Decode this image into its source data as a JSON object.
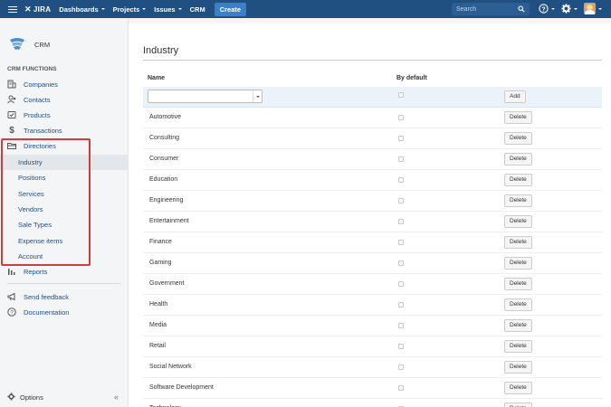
{
  "topnav": {
    "logo": "JIRA",
    "menus": [
      {
        "label": "Dashboards",
        "dropdown": true
      },
      {
        "label": "Projects",
        "dropdown": true
      },
      {
        "label": "Issues",
        "dropdown": true
      },
      {
        "label": "CRM",
        "dropdown": false
      }
    ],
    "create_label": "Create",
    "search_placeholder": "Search",
    "colors": {
      "bar": "#205081",
      "create": "#3b7fc4"
    }
  },
  "sidebar": {
    "project_name": "CRM",
    "section_title": "CRM FUNCTIONS",
    "items": [
      {
        "label": "Companies",
        "icon": "building-icon"
      },
      {
        "label": "Contacts",
        "icon": "contacts-icon"
      },
      {
        "label": "Products",
        "icon": "products-icon"
      },
      {
        "label": "Transactions",
        "icon": "dollar-icon"
      },
      {
        "label": "Directories",
        "icon": "folder-icon"
      }
    ],
    "sub_items": [
      "Industry",
      "Positions",
      "Services",
      "Vendors",
      "Sale Types",
      "Expense items",
      "Account"
    ],
    "reports_label": "Reports",
    "feedback_label": "Send feedback",
    "documentation_label": "Documentation",
    "options_label": "Options",
    "collapse_label": "«",
    "highlight_color": "#d13c3c"
  },
  "main": {
    "title": "Industry",
    "columns": {
      "name": "Name",
      "default": "By default"
    },
    "add_label": "Add",
    "delete_label": "Delete",
    "rows": [
      "Automotive",
      "Consulting",
      "Consumer",
      "Education",
      "Engineering",
      "Entertainment",
      "Finance",
      "Gaming",
      "Government",
      "Health",
      "Media",
      "Retail",
      "Social Network",
      "Software Development",
      "Technology"
    ]
  }
}
